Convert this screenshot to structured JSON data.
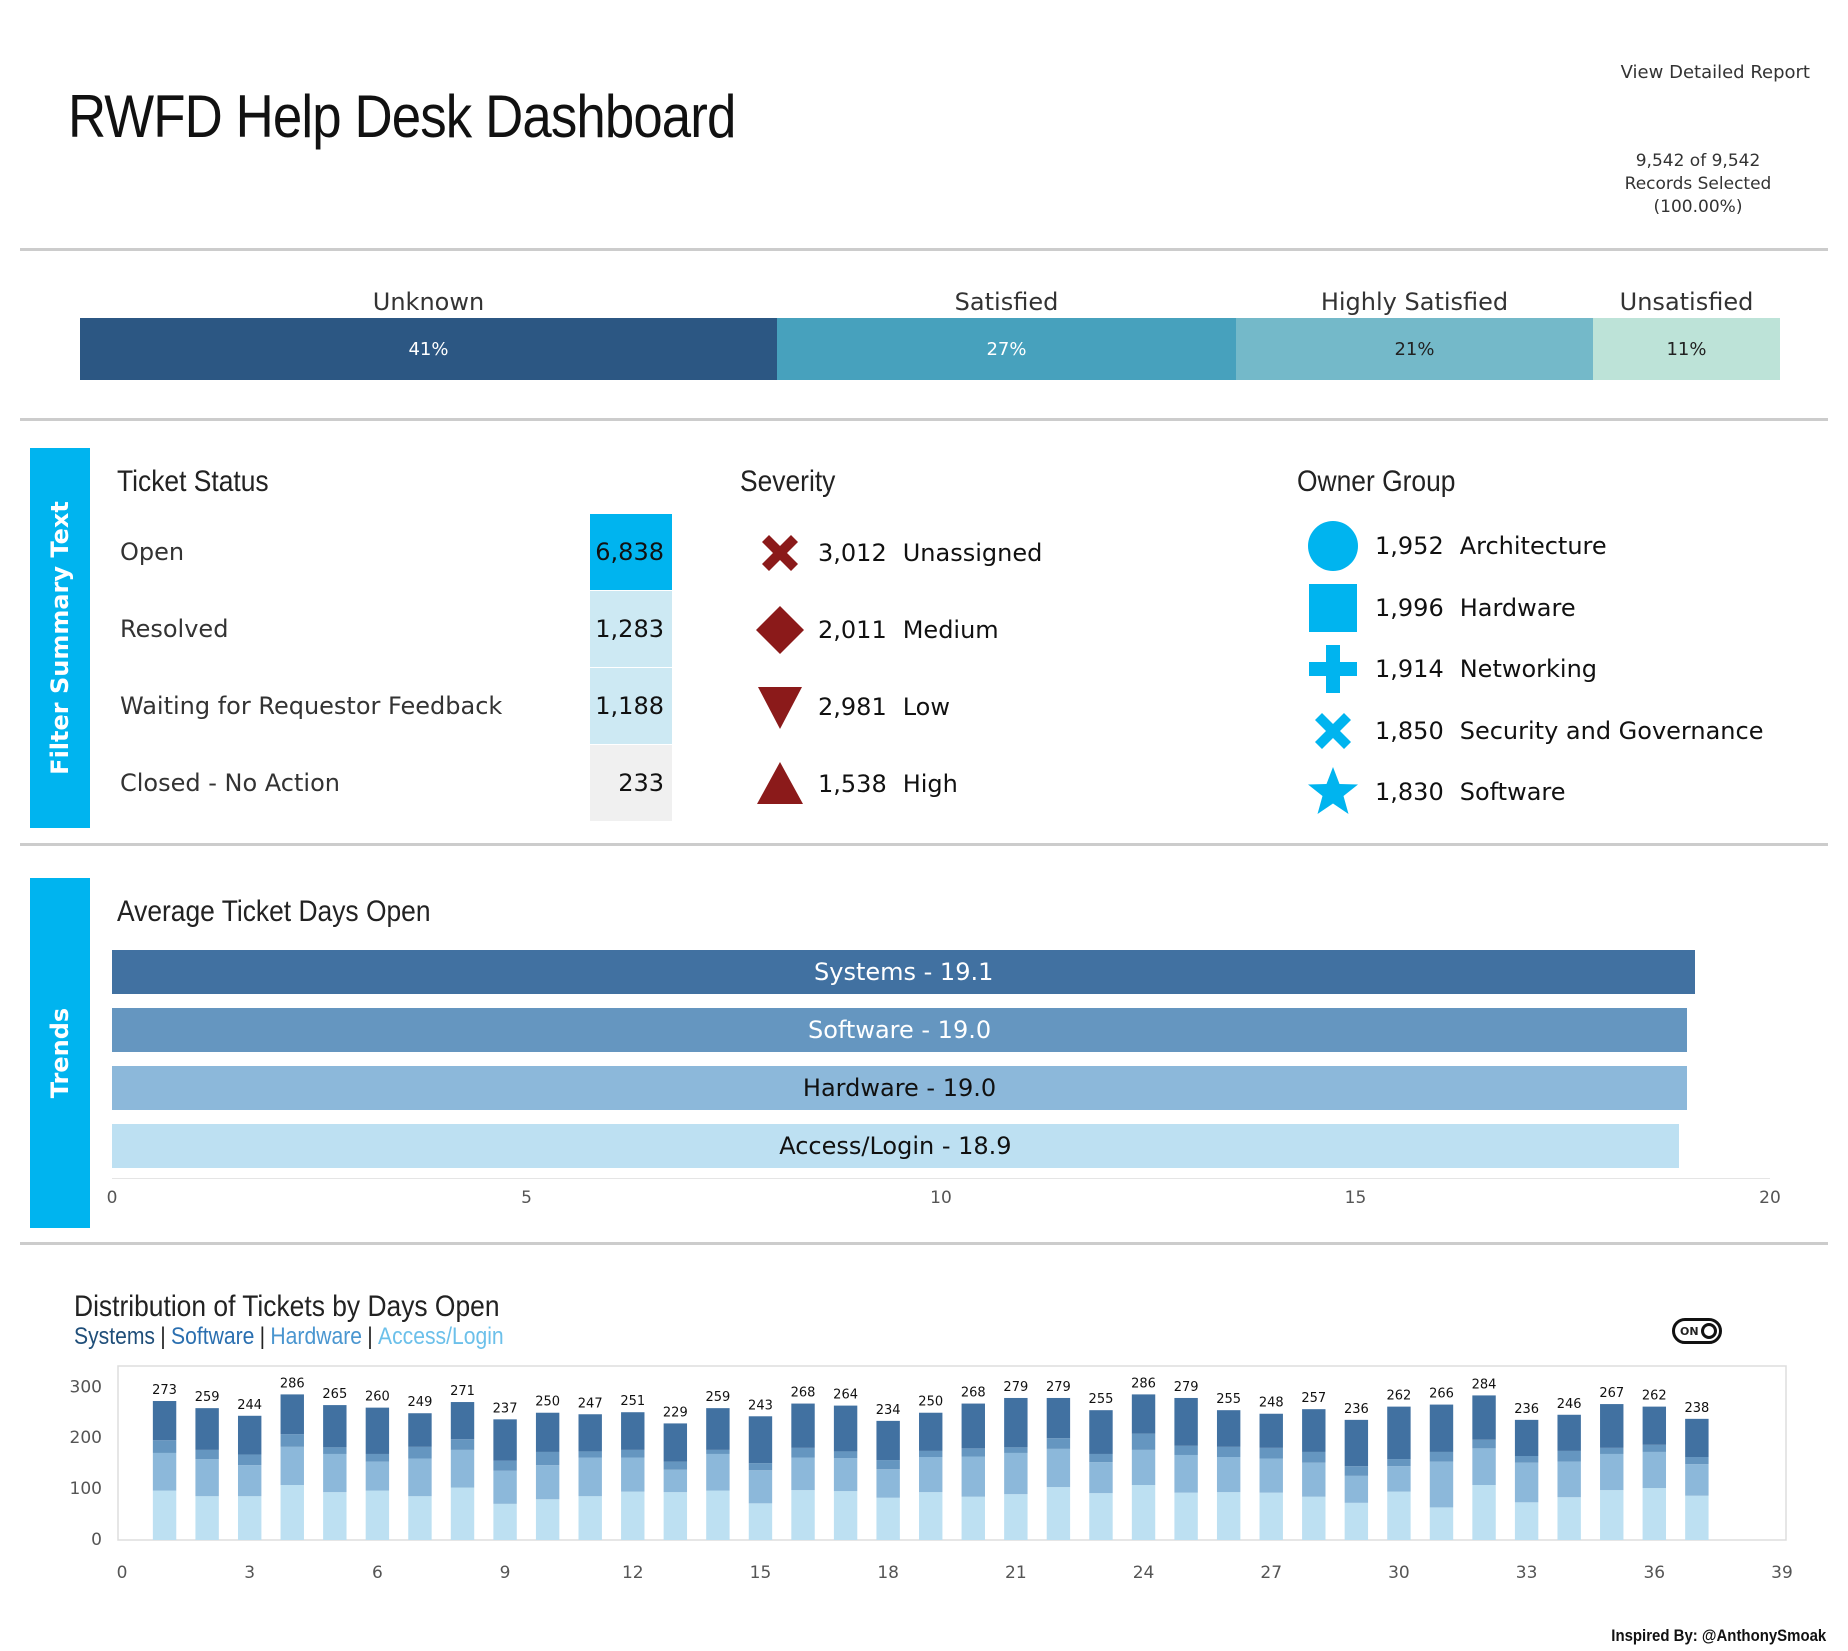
{
  "header": {
    "title": "RWFD Help Desk Dashboard",
    "report_link": "View Detailed Report",
    "records_line1": "9,542 of 9,542",
    "records_line2": "Records Selected",
    "records_line3": "(100.00%)"
  },
  "satisfaction": [
    {
      "label": "Unknown",
      "pct": "41%",
      "value": 41,
      "color": "#2c5783",
      "text_color": "#ffffff"
    },
    {
      "label": "Satisfied",
      "pct": "27%",
      "value": 27,
      "color": "#47a1bd",
      "text_color": "#ffffff"
    },
    {
      "label": "Highly Satisfied",
      "pct": "21%",
      "value": 21,
      "color": "#74b9c9",
      "text_color": "#222222"
    },
    {
      "label": "Unsatisfied",
      "pct": "11%",
      "value": 11,
      "color": "#bde3d8",
      "text_color": "#222222"
    }
  ],
  "side_tabs": {
    "filter": "Filter Summary Text",
    "trends": "Trends"
  },
  "ticket_status": {
    "title": "Ticket Status",
    "rows": [
      {
        "label": "Open",
        "value": "6,838",
        "color": "#00b4ef"
      },
      {
        "label": "Resolved",
        "value": "1,283",
        "color": "#cde9f3"
      },
      {
        "label": "Waiting for Requestor Feedback",
        "value": "1,188",
        "color": "#cde9f3"
      },
      {
        "label": "Closed - No Action",
        "value": "233",
        "color": "#f0f0f0"
      }
    ]
  },
  "severity": {
    "title": "Severity",
    "rows": [
      {
        "icon": "x-icon",
        "value": "3,012",
        "label": "Unassigned"
      },
      {
        "icon": "diamond-icon",
        "value": "2,011",
        "label": "Medium"
      },
      {
        "icon": "triangle-down-icon",
        "value": "2,981",
        "label": "Low"
      },
      {
        "icon": "triangle-up-icon",
        "value": "1,538",
        "label": "High"
      }
    ],
    "color": "#8b1a1a"
  },
  "owner_group": {
    "title": "Owner Group",
    "rows": [
      {
        "icon": "circle-icon",
        "value": "1,952",
        "label": "Architecture"
      },
      {
        "icon": "square-icon",
        "value": "1,996",
        "label": "Hardware"
      },
      {
        "icon": "plus-icon",
        "value": "1,914",
        "label": "Networking"
      },
      {
        "icon": "x-icon",
        "value": "1,850",
        "label": "Security and Governance"
      },
      {
        "icon": "star-icon",
        "value": "1,830",
        "label": "Software"
      }
    ],
    "color": "#00b4ef"
  },
  "avg_days": {
    "title": "Average Ticket Days Open",
    "bars": [
      {
        "label": "Systems - 19.1",
        "value": 19.1,
        "color": "#4171a1",
        "text_color": "#ffffff"
      },
      {
        "label": "Software - 19.0",
        "value": 19.0,
        "color": "#6596c0",
        "text_color": "#ffffff"
      },
      {
        "label": "Hardware - 19.0",
        "value": 19.0,
        "color": "#8cb8da",
        "text_color": "#111111"
      },
      {
        "label": "Access/Login - 18.9",
        "value": 18.9,
        "color": "#bde0f2",
        "text_color": "#111111"
      }
    ],
    "ticks": [
      "0",
      "5",
      "10",
      "15",
      "20"
    ],
    "xlim": [
      0,
      20
    ]
  },
  "distribution": {
    "title": "Distribution of Tickets by Days Open",
    "legend": [
      {
        "name": "Systems",
        "color": "#1f4e79"
      },
      {
        "name": "Software",
        "color": "#2a6fb0"
      },
      {
        "name": "Hardware",
        "color": "#4a96d0"
      },
      {
        "name": "Access/Login",
        "color": "#6cc0ea"
      }
    ],
    "separator": "|",
    "toggle_label": "ON"
  },
  "chart_data": {
    "type": "bar",
    "stacked": true,
    "x": [
      1,
      2,
      3,
      4,
      5,
      6,
      7,
      8,
      9,
      10,
      11,
      12,
      13,
      14,
      15,
      16,
      17,
      18,
      19,
      20,
      21,
      22,
      23,
      24,
      25,
      26,
      27,
      28,
      29,
      30,
      31,
      32,
      33,
      34,
      35,
      36,
      37
    ],
    "totals": [
      273,
      259,
      244,
      286,
      265,
      260,
      249,
      271,
      237,
      250,
      247,
      251,
      229,
      259,
      243,
      268,
      264,
      234,
      250,
      268,
      279,
      279,
      255,
      286,
      279,
      255,
      248,
      257,
      236,
      262,
      266,
      284,
      236,
      246,
      267,
      262,
      238
    ],
    "series": [
      {
        "name": "Access/Login",
        "color": "#bde0f2",
        "values": [
          97,
          86,
          86,
          108,
          94,
          97,
          86,
          103,
          71,
          80,
          86,
          95,
          94,
          97,
          72,
          98,
          96,
          83,
          94,
          85,
          90,
          104,
          92,
          108,
          93,
          94,
          93,
          85,
          73,
          95,
          64,
          108,
          74,
          84,
          98,
          102,
          87
        ]
      },
      {
        "name": "Hardware",
        "color": "#8cb8da",
        "values": [
          74,
          73,
          61,
          75,
          75,
          57,
          74,
          74,
          65,
          67,
          76,
          67,
          44,
          72,
          65,
          64,
          65,
          56,
          69,
          79,
          81,
          75,
          61,
          69,
          74,
          69,
          67,
          67,
          53,
          50,
          90,
          72,
          78,
          70,
          71,
          71,
          62
        ]
      },
      {
        "name": "Software",
        "color": "#6596c0",
        "values": [
          25,
          18,
          21,
          25,
          13,
          15,
          23,
          21,
          20,
          26,
          12,
          15,
          16,
          8,
          14,
          19,
          13,
          18,
          12,
          16,
          11,
          21,
          16,
          32,
          18,
          20,
          21,
          21,
          19,
          14,
          19,
          17,
          13,
          21,
          12,
          14,
          14
        ]
      },
      {
        "name": "Systems",
        "color": "#4171a1",
        "values": [
          77,
          82,
          76,
          78,
          83,
          91,
          66,
          73,
          81,
          77,
          73,
          74,
          75,
          82,
          92,
          87,
          90,
          77,
          75,
          88,
          97,
          79,
          86,
          77,
          94,
          72,
          67,
          84,
          91,
          103,
          93,
          87,
          71,
          71,
          86,
          75,
          75
        ]
      }
    ],
    "xticks": [
      0,
      3,
      6,
      9,
      12,
      15,
      18,
      21,
      24,
      27,
      30,
      33,
      36,
      39
    ],
    "xlim": [
      0,
      39
    ],
    "yticks": [
      0,
      100,
      200,
      300
    ],
    "ylim": [
      0,
      330
    ]
  },
  "footer": {
    "credit": "Inspired By: @AnthonySmoak"
  }
}
